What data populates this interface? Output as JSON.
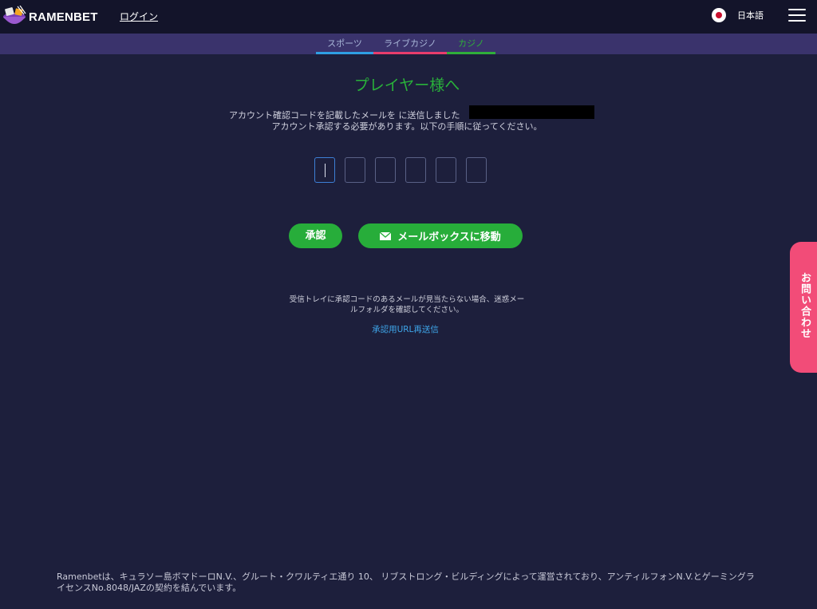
{
  "header": {
    "brand": "RAMENBET",
    "login_label": "ログイン",
    "language_label": "日本語",
    "icons": [
      "ramen-bowl-logo-icon",
      "japan-flag-icon",
      "hamburger-menu-icon"
    ]
  },
  "subnav": {
    "tabs": [
      {
        "label": "スポーツ",
        "underline_color": "#2f9fe3"
      },
      {
        "label": "ライブカジノ",
        "underline_color": "#e83d6c"
      },
      {
        "label": "カジノ",
        "underline_color": "#2fae3a",
        "active": true
      }
    ]
  },
  "main": {
    "heading": "プレイヤー様へ",
    "message_line1": "アカウント確認コードを記載したメールを に送信しました",
    "message_line2": "アカウント承認する必要があります。以下の手順に従ってください。",
    "code_digits": [
      "",
      "",
      "",
      "",
      "",
      ""
    ],
    "approve_label": "承認",
    "mailbox_label": "メールボックスに移動",
    "help_text": "受信トレイに承認コードのあるメールが見当たらない場合、迷惑メールフォルダを確認してください。",
    "resend_label": "承認用URL再送信"
  },
  "contact_tab_label": "お問い合わせ",
  "footer_text": "Ramenbetは、キュラソー島ボマドーロN.V.、グルート・クワルティエ通り 10、 リブストロング・ビルディングによって運営されており、アンティルフォンN.V.とゲーミングライセンスNo.8048/JAZの契約を結んでいます。",
  "colors": {
    "background": "#1d1f3c",
    "topbar": "#13142a",
    "subnav": "#3a336c",
    "accent_green": "#27ad3a",
    "link_blue": "#3ea6ea",
    "contact_pink": "#f24c78"
  }
}
